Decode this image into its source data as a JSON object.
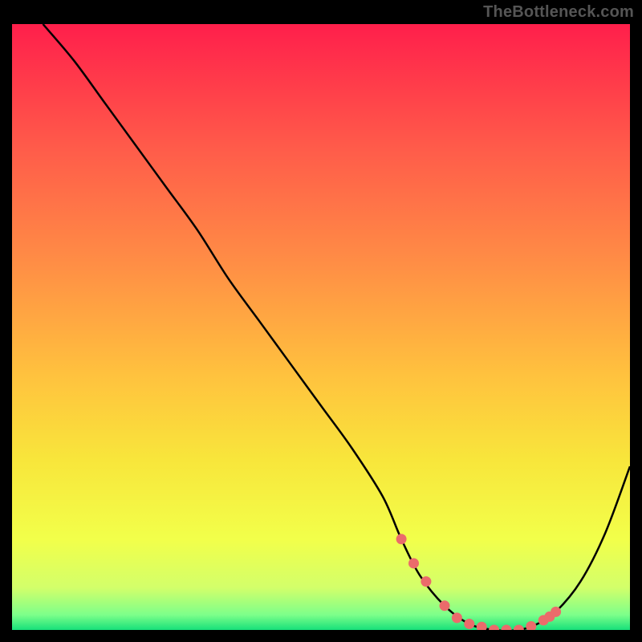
{
  "watermark": "TheBottleneck.com",
  "colors": {
    "page_bg": "#000000",
    "curve": "#000000",
    "marker": "#eb6b6b",
    "gradient_stops": [
      {
        "offset": 0.0,
        "color": "#ff1f4b"
      },
      {
        "offset": 0.2,
        "color": "#ff5a4a"
      },
      {
        "offset": 0.4,
        "color": "#ff8f45"
      },
      {
        "offset": 0.58,
        "color": "#ffc23e"
      },
      {
        "offset": 0.72,
        "color": "#f8e63b"
      },
      {
        "offset": 0.85,
        "color": "#f2ff4a"
      },
      {
        "offset": 0.93,
        "color": "#d3ff6a"
      },
      {
        "offset": 0.975,
        "color": "#7dff8a"
      },
      {
        "offset": 1.0,
        "color": "#17e07a"
      }
    ]
  },
  "chart_data": {
    "type": "line",
    "title": "",
    "xlabel": "",
    "ylabel": "",
    "xlim": [
      0,
      100
    ],
    "ylim": [
      0,
      100
    ],
    "series": [
      {
        "name": "bottleneck-curve",
        "x": [
          5,
          10,
          15,
          20,
          25,
          30,
          35,
          40,
          45,
          50,
          55,
          60,
          63,
          66,
          70,
          74,
          78,
          82,
          85,
          88,
          92,
          96,
          100
        ],
        "y": [
          100,
          94,
          87,
          80,
          73,
          66,
          58,
          51,
          44,
          37,
          30,
          22,
          15,
          9,
          4,
          1,
          0,
          0,
          1,
          3,
          8,
          16,
          27
        ]
      }
    ],
    "markers": {
      "name": "highlight-points",
      "x": [
        63,
        65,
        67,
        70,
        72,
        74,
        76,
        78,
        80,
        82,
        84,
        86,
        87,
        88
      ],
      "y": [
        15,
        11,
        8,
        4,
        2,
        1,
        0.5,
        0,
        0,
        0,
        0.6,
        1.6,
        2.2,
        3
      ]
    }
  }
}
